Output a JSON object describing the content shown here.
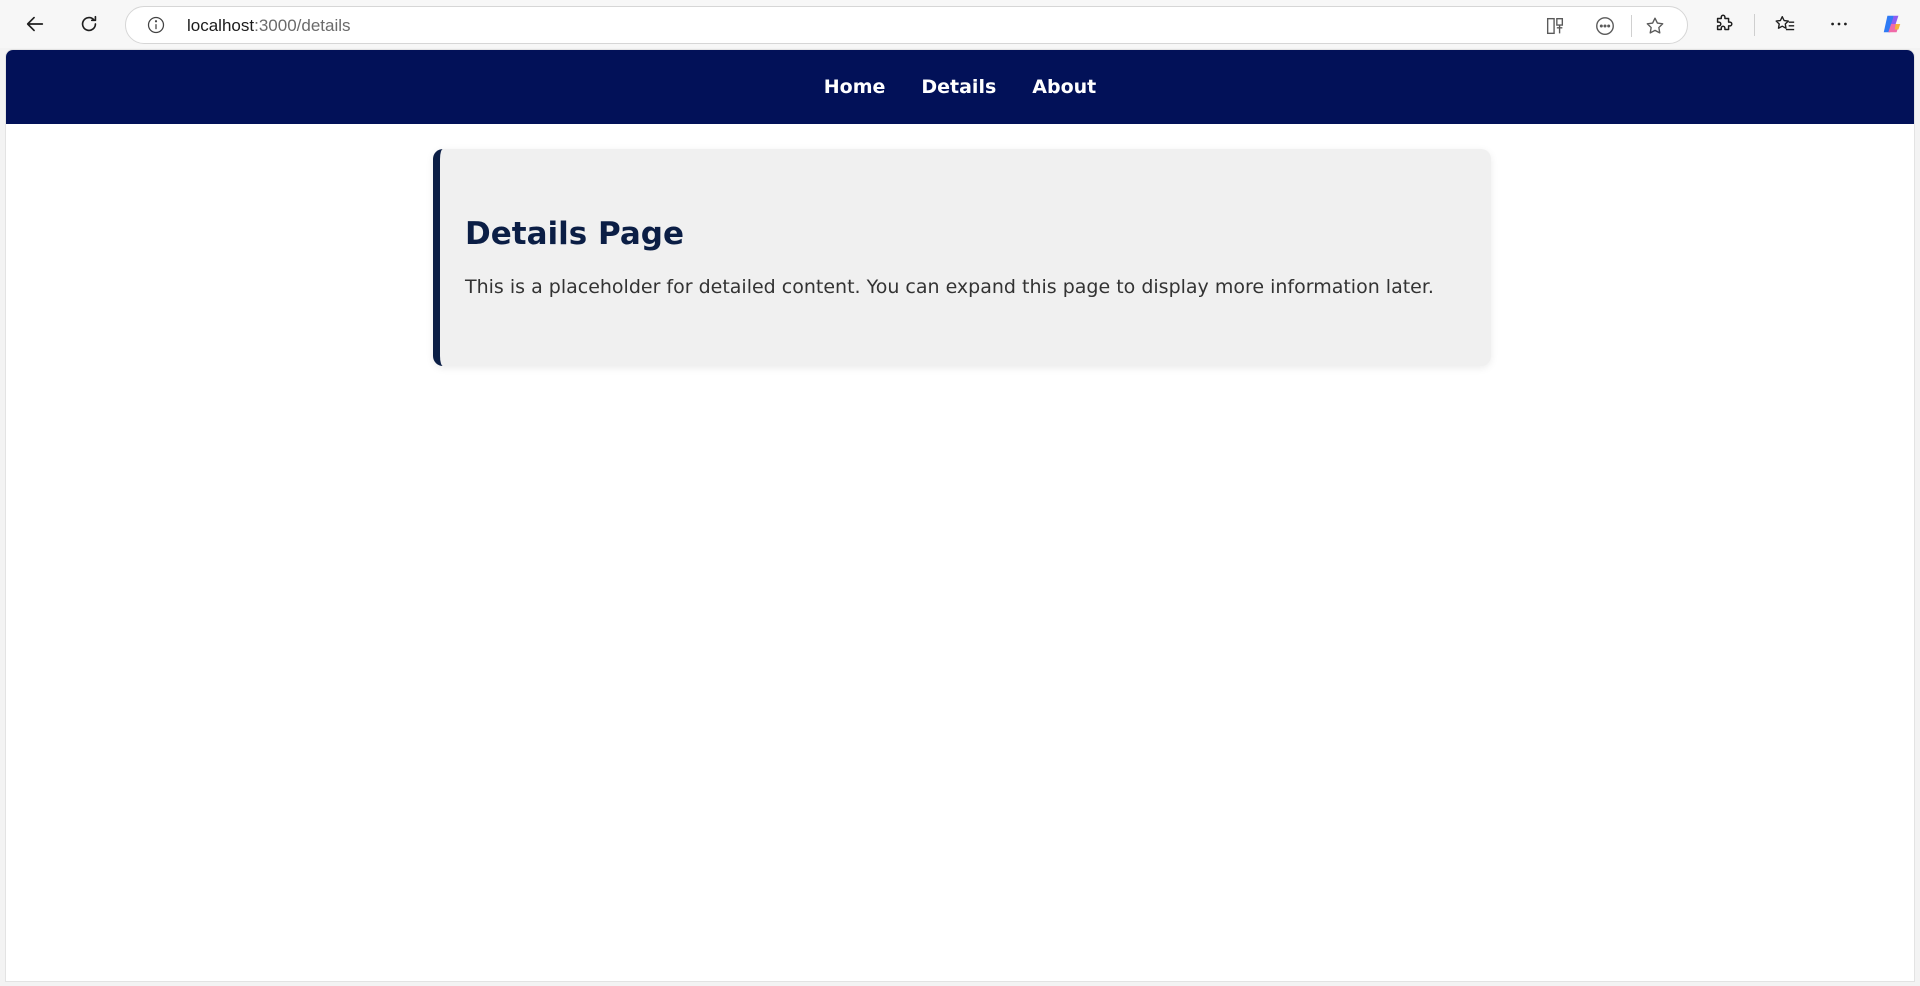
{
  "browser": {
    "url_host": "localhost",
    "url_path": ":3000/details",
    "icons": {
      "back": "arrow-left-icon",
      "refresh": "refresh-icon",
      "site_info": "info-icon",
      "split_screen": "split-screen-icon",
      "reader": "reading-mode-icon",
      "favorite": "star-icon",
      "extensions": "puzzle-icon",
      "favorites": "favorites-list-icon",
      "more": "more-icon",
      "copilot": "copilot-icon"
    }
  },
  "nav": {
    "items": [
      {
        "label": "Home"
      },
      {
        "label": "Details"
      },
      {
        "label": "About"
      }
    ]
  },
  "content": {
    "title": "Details Page",
    "description": "This is a placeholder for detailed content. You can expand this page to display more information later."
  },
  "colors": {
    "navbar": "#021158",
    "card_bg": "#f0f0f0",
    "card_accent": "#0b1e45",
    "title": "#0b1e45"
  }
}
